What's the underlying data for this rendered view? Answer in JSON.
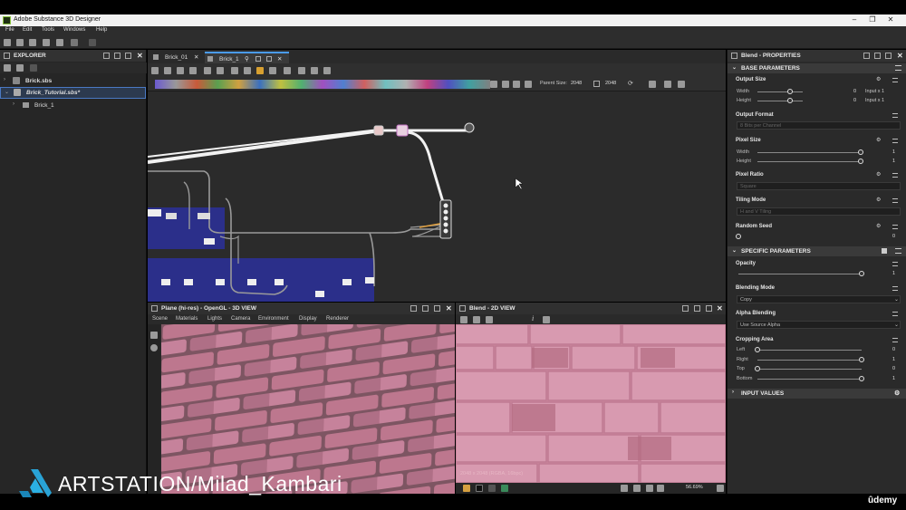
{
  "app": {
    "title": "Adobe Substance 3D Designer"
  },
  "menu": [
    "File",
    "Edit",
    "Tools",
    "Windows",
    "Help"
  ],
  "explorer": {
    "title": "EXPLORER",
    "items": [
      {
        "label": "Brick.sbs"
      },
      {
        "label": "Brick_Tutorial.sbs*"
      },
      {
        "label": "Brick_1"
      }
    ]
  },
  "graph": {
    "tabs": [
      {
        "label": "Brick_01"
      },
      {
        "label": "Brick_1"
      }
    ],
    "parent_size_label": "Parent Size:",
    "parent_size_value": "2048",
    "size_value": "2048"
  },
  "view3d": {
    "title": "Plane (hi-res) - OpenGL - 3D VIEW",
    "menu": [
      "Scene",
      "Materials",
      "Lights",
      "Camera",
      "Environment",
      "Display",
      "Renderer"
    ]
  },
  "view2d": {
    "title": "Blend - 2D VIEW",
    "info": "2048 x 2048 (RGBA, 16bpc)",
    "zoom": "56.69%"
  },
  "properties": {
    "title": "Blend - PROPERTIES",
    "base_header": "BASE PARAMETERS",
    "output_size": {
      "label": "Output Size",
      "width_label": "Width",
      "height_label": "Height",
      "width_value": "0",
      "height_value": "0",
      "width_mode": "Input x 1",
      "height_mode": "Input x 1"
    },
    "output_format": {
      "label": "Output Format",
      "value": "8 Bits per Channel"
    },
    "pixel_size": {
      "label": "Pixel Size",
      "width_label": "Width",
      "height_label": "Height",
      "width_value": "1",
      "height_value": "1"
    },
    "pixel_ratio": {
      "label": "Pixel Ratio",
      "value": "Square"
    },
    "tiling_mode": {
      "label": "Tiling Mode",
      "value": "H and V Tiling"
    },
    "random_seed": {
      "label": "Random Seed",
      "value": "0"
    },
    "specific_header": "SPECIFIC PARAMETERS",
    "opacity": {
      "label": "Opacity",
      "value": "1"
    },
    "blending_mode": {
      "label": "Blending Mode",
      "value": "Copy"
    },
    "alpha_blending": {
      "label": "Alpha Blending",
      "value": "Use Source Alpha"
    },
    "cropping": {
      "label": "Cropping Area",
      "rows": [
        {
          "label": "Left",
          "value": "0",
          "fraction": 0
        },
        {
          "label": "Right",
          "value": "1",
          "fraction": 1
        },
        {
          "label": "Top",
          "value": "0",
          "fraction": 0
        },
        {
          "label": "Bottom",
          "value": "1",
          "fraction": 1
        }
      ]
    },
    "input_values_header": "INPUT VALUES"
  },
  "watermark": {
    "text": "ARTSTATION/Milad_Kambari"
  },
  "udemy": {
    "text": "ûdemy"
  },
  "colors": {
    "accent": "#4a9bf0",
    "node_blue": "#2b2f8f",
    "brick": "#c07a8e"
  }
}
